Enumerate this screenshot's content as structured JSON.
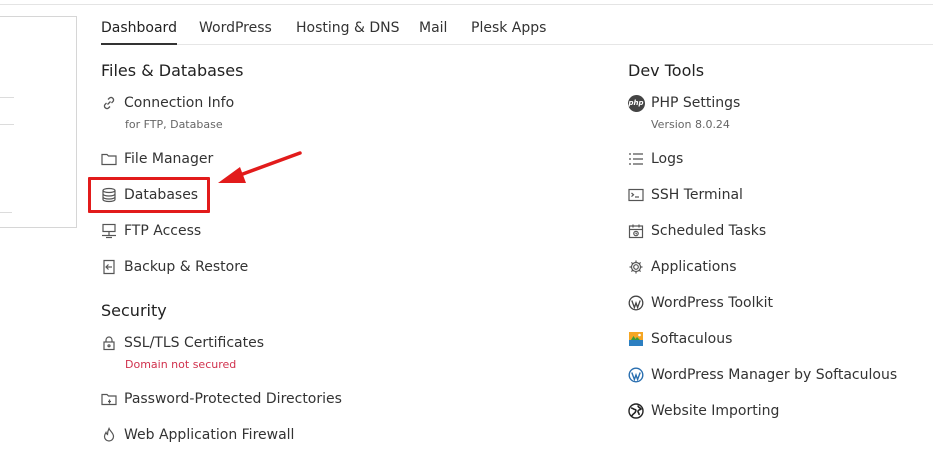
{
  "tabs": [
    {
      "label": "Dashboard",
      "active": true
    },
    {
      "label": "WordPress"
    },
    {
      "label": "Hosting & DNS"
    },
    {
      "label": "Mail"
    },
    {
      "label": "Plesk Apps"
    }
  ],
  "files_databases": {
    "title": "Files & Databases",
    "items": [
      {
        "label": "Connection Info",
        "sub": "for FTP, Database",
        "icon": "link-icon"
      },
      {
        "label": "File Manager",
        "icon": "folder-icon"
      },
      {
        "label": "Databases",
        "icon": "database-icon"
      },
      {
        "label": "FTP Access",
        "icon": "ftp-icon"
      },
      {
        "label": "Backup & Restore",
        "icon": "backup-icon"
      }
    ]
  },
  "security": {
    "title": "Security",
    "items": [
      {
        "label": "SSL/TLS Certificates",
        "sub": "Domain not secured",
        "icon": "lock-icon"
      },
      {
        "label": "Password-Protected Directories",
        "icon": "locked-folder-icon"
      },
      {
        "label": "Web Application Firewall",
        "icon": "flame-icon"
      }
    ]
  },
  "dev_tools": {
    "title": "Dev Tools",
    "items": [
      {
        "label": "PHP Settings",
        "sub": "Version 8.0.24",
        "icon": "php-icon"
      },
      {
        "label": "Logs",
        "icon": "list-icon"
      },
      {
        "label": "SSH Terminal",
        "icon": "terminal-icon"
      },
      {
        "label": "Scheduled Tasks",
        "icon": "calendar-icon"
      },
      {
        "label": "Applications",
        "icon": "gear-icon"
      },
      {
        "label": "WordPress Toolkit",
        "icon": "wordpress-icon"
      },
      {
        "label": "Softaculous",
        "icon": "softaculous-icon"
      },
      {
        "label": "WordPress Manager by Softaculous",
        "icon": "wordpress-icon"
      },
      {
        "label": "Website Importing",
        "icon": "globe-icon"
      }
    ]
  },
  "php_icon_text": "php",
  "colors": {
    "highlight": "#e21b1b",
    "warning_text": "#d0314d"
  }
}
